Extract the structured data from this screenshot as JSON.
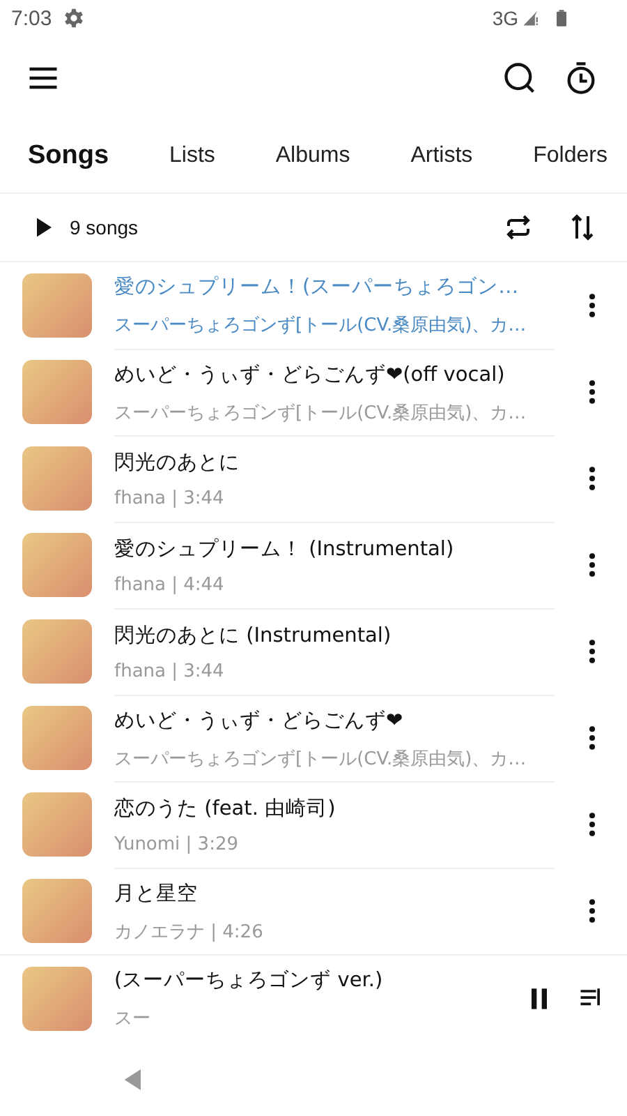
{
  "status_bar": {
    "time": "7:03",
    "network": "3G"
  },
  "tabs": [
    {
      "label": "Songs",
      "selected": true
    },
    {
      "label": "Lists",
      "selected": false
    },
    {
      "label": "Albums",
      "selected": false
    },
    {
      "label": "Artists",
      "selected": false
    },
    {
      "label": "Folders",
      "selected": false
    }
  ],
  "list_header": {
    "count": "9 songs"
  },
  "songs": [
    {
      "title": "愛のシュプリーム！(スーパーちょろゴン…",
      "subtitle": "スーパーちょろゴンず[トール(CV.桑原由気)、カ…",
      "selected": true
    },
    {
      "title": "めいど・うぃず・どらごんず❤(off vocal)",
      "subtitle": "スーパーちょろゴンず[トール(CV.桑原由気)、カ…",
      "selected": false
    },
    {
      "title": "閃光のあとに",
      "subtitle": "fhana | 3:44",
      "selected": false
    },
    {
      "title": "愛のシュプリーム！ (Instrumental)",
      "subtitle": "fhana | 4:44",
      "selected": false
    },
    {
      "title": "閃光のあとに (Instrumental)",
      "subtitle": "fhana | 3:44",
      "selected": false
    },
    {
      "title": "めいど・うぃず・どらごんず❤",
      "subtitle": "スーパーちょろゴンず[トール(CV.桑原由気)、カ…",
      "selected": false
    },
    {
      "title": "恋のうた (feat. 由崎司)",
      "subtitle": "Yunomi | 3:29",
      "selected": false
    },
    {
      "title": "月と星空",
      "subtitle": "カノエラナ | 4:26",
      "selected": false
    }
  ],
  "mini_player": {
    "title": "(スーパーちょろゴンず ver.)",
    "subtitle": "スー"
  }
}
